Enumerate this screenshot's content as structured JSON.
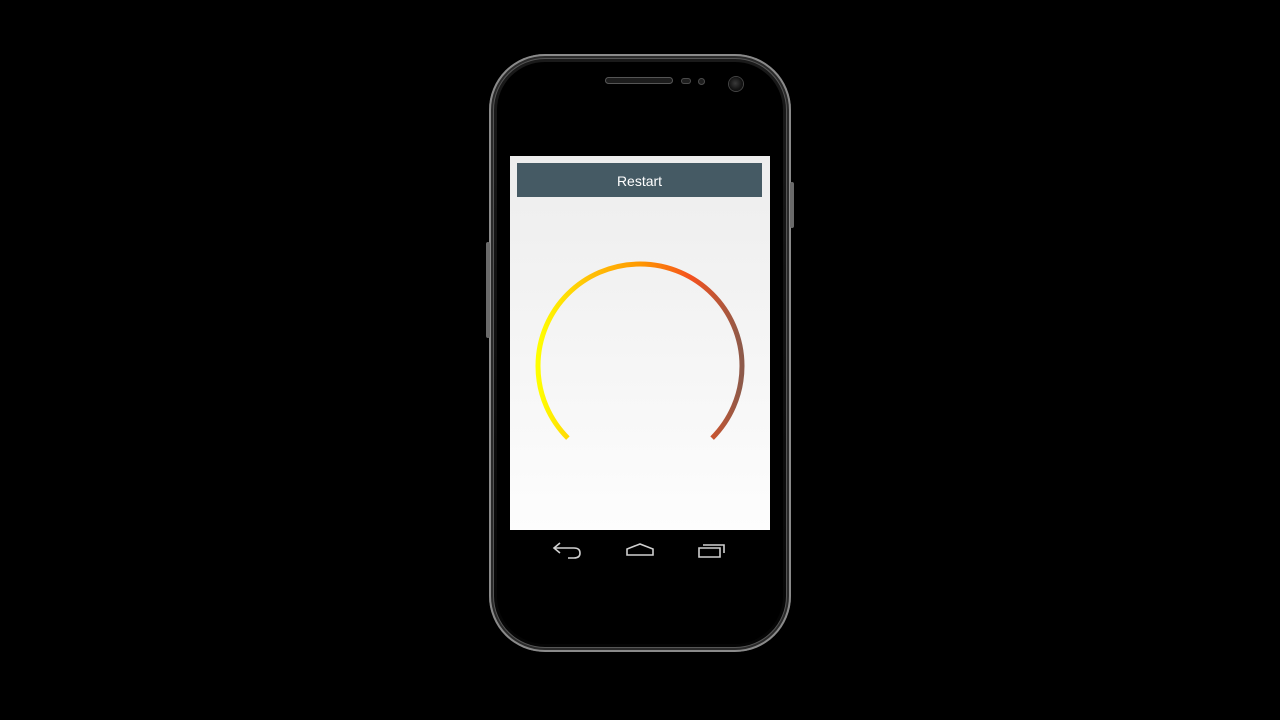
{
  "app": {
    "restart_label": "Restart"
  },
  "gauge": {
    "progress": 1.0,
    "gradient_colors": [
      "#ffff00",
      "#ffc107",
      "#ff9800",
      "#f4511e",
      "#8d5a4a"
    ],
    "stroke_color_start": "#ffff00",
    "stroke_color_end": "#8d5a4a"
  },
  "navbar": {
    "icons": [
      "back-icon",
      "home-icon",
      "recent-apps-icon"
    ],
    "icon_color": "#cfcfcf"
  },
  "colors": {
    "button_bg": "#455a64",
    "button_text": "#ffffff",
    "background": "#000000"
  }
}
